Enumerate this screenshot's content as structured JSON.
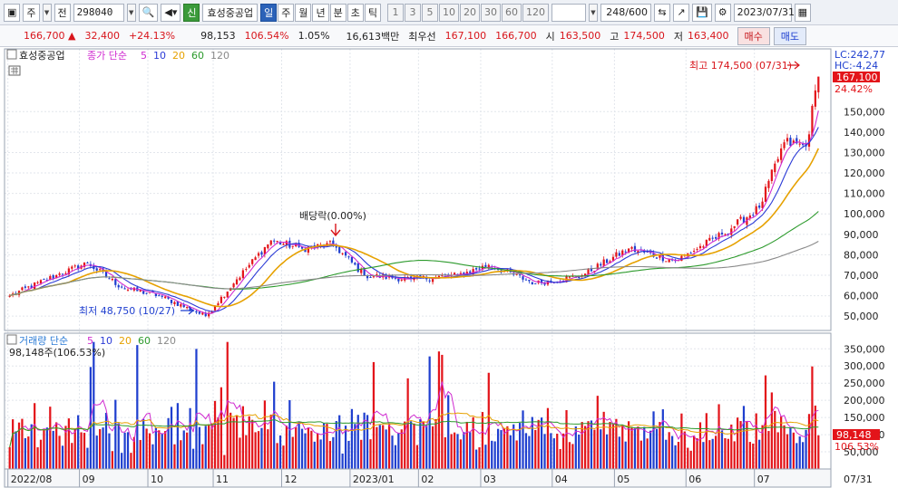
{
  "toolbar": {
    "market_label": "주",
    "market_sub_label": "전",
    "stock_code": "298040",
    "stock_name": "효성중공업",
    "credit_label": "신",
    "period_tabs": [
      {
        "label": "일",
        "selected": true
      },
      {
        "label": "주",
        "selected": false
      },
      {
        "label": "월",
        "selected": false
      },
      {
        "label": "년",
        "selected": false
      },
      {
        "label": "분",
        "selected": false
      },
      {
        "label": "초",
        "selected": false
      },
      {
        "label": "틱",
        "selected": false
      }
    ],
    "interval_buttons": [
      "1",
      "3",
      "5",
      "10",
      "20",
      "30",
      "60",
      "120"
    ],
    "count_display": "248/600",
    "date_display": "2023/07/31"
  },
  "quote": {
    "price": "166,700",
    "change_arrow": "▲",
    "change": "32,400",
    "change_pct": "+24.13%",
    "volume": "98,153",
    "volume_ratio": "106.54%",
    "turnover_rate": "1.05%",
    "trade_value": "16,613백만",
    "best_ask_label": "최우선",
    "best_ask": "167,100",
    "best_bid": "166,700",
    "open_label": "시",
    "open": "163,500",
    "high_label": "고",
    "high": "174,500",
    "low_label": "저",
    "low": "163,400",
    "buy_label": "매수",
    "sell_label": "매도"
  },
  "chart": {
    "stock_legend": "효성중공업",
    "price_legend_label": "종가 단순",
    "ma_periods": [
      "5",
      "10",
      "20",
      "60",
      "120"
    ],
    "volume_legend_label": "거래량 단순",
    "volume_readout": "98,148주(106.53%)",
    "high_annotation": "최고 174,500 (07/31)",
    "low_annotation": "최저 48,750 (10/27)",
    "dividend_annotation": "배당락(0.00%)",
    "lc_label": "LC:242,77",
    "hc_label": "HC:-4,24",
    "last_price_label": "167,100",
    "last_pct_label": "24.42%",
    "last_volume_label": "98,148",
    "last_volume_pct_label": "106.53%",
    "date_tail_label": "07/31",
    "colors": {
      "up": "#e3141a",
      "down": "#1f3fcf",
      "ma5": "#d02ad0",
      "ma10": "#2b3bd6",
      "ma20": "#e6a100",
      "ma60": "#2c9a2c",
      "ma120": "#8a8a8a"
    }
  },
  "chart_data": {
    "type": "line",
    "title": "효성중공업",
    "price_axis": {
      "ticks": [
        50000,
        60000,
        70000,
        80000,
        90000,
        100000,
        110000,
        120000,
        130000,
        140000,
        150000
      ],
      "tick_labels": [
        "50,000",
        "60,000",
        "70,000",
        "80,000",
        "90,000",
        "100,000",
        "110,000",
        "120,000",
        "130,000",
        "140,000",
        "150,000"
      ],
      "ylim": [
        43000,
        178000
      ]
    },
    "volume_axis": {
      "ticks": [
        50000,
        100000,
        150000,
        200000,
        250000,
        300000,
        350000
      ],
      "tick_labels": [
        "50,000",
        "100,000",
        "150,000",
        "200,000",
        "250,000",
        "300,000",
        "350,000"
      ],
      "ylim": [
        0,
        385000
      ]
    },
    "x_axis_labels": [
      "2022/08",
      "09",
      "10",
      "11",
      "12",
      "2023/01",
      "02",
      "03",
      "04",
      "05",
      "06",
      "07"
    ],
    "close_keypoints": [
      {
        "date": "2022-08-01",
        "close": 60000
      },
      {
        "date": "2022-08-22",
        "close": 70000
      },
      {
        "date": "2022-09-05",
        "close": 76000
      },
      {
        "date": "2022-09-20",
        "close": 64000
      },
      {
        "date": "2022-10-06",
        "close": 60000
      },
      {
        "date": "2022-10-27",
        "close": 50000
      },
      {
        "date": "2022-11-10",
        "close": 68000
      },
      {
        "date": "2022-11-25",
        "close": 87000
      },
      {
        "date": "2022-12-09",
        "close": 83000
      },
      {
        "date": "2022-12-23",
        "close": 85000
      },
      {
        "date": "2023-01-06",
        "close": 70000
      },
      {
        "date": "2023-01-27",
        "close": 68000
      },
      {
        "date": "2023-02-17",
        "close": 70000
      },
      {
        "date": "2023-03-03",
        "close": 75000
      },
      {
        "date": "2023-03-24",
        "close": 66000
      },
      {
        "date": "2023-04-14",
        "close": 70000
      },
      {
        "date": "2023-05-05",
        "close": 83000
      },
      {
        "date": "2023-05-26",
        "close": 77000
      },
      {
        "date": "2023-06-16",
        "close": 90000
      },
      {
        "date": "2023-07-04",
        "close": 103000
      },
      {
        "date": "2023-07-14",
        "close": 135000
      },
      {
        "date": "2023-07-25",
        "close": 133000
      },
      {
        "date": "2023-07-31",
        "close": 167100
      }
    ],
    "moving_average_endpoints": [
      {
        "name": "5",
        "start": 58000,
        "end": 141000
      },
      {
        "name": "10",
        "start": 57000,
        "end": 138000
      },
      {
        "name": "20",
        "start": 55000,
        "end": 132000
      },
      {
        "name": "60",
        "start": 60000,
        "end": 103000
      },
      {
        "name": "120",
        "start": 62000,
        "end": 88000
      }
    ],
    "annotations": [
      {
        "text": "최고 174,500 (07/31)",
        "date": "2023-07-31",
        "value": 174500
      },
      {
        "text": "최저 48,750 (10/27)",
        "date": "2022-10-27",
        "value": 48750
      },
      {
        "text": "배당락(0.00%)",
        "date": "2022-12-28",
        "value": 86000
      }
    ],
    "last_close": 167100,
    "last_volume": 98148,
    "grid": true
  }
}
